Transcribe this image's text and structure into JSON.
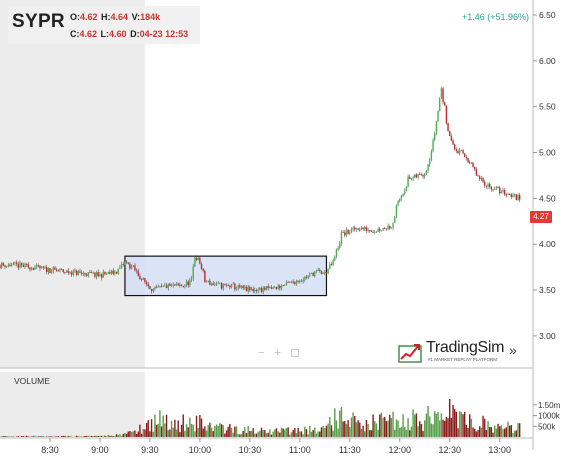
{
  "ticker": "SYPR",
  "ohlc": {
    "o_label": "O:",
    "o_value": "4.62",
    "h_label": "H:",
    "h_value": "4.64",
    "v_label": "V:",
    "v_value": "184k",
    "c_label": "C:",
    "c_value": "4.62",
    "l_label": "L:",
    "l_value": "4.60",
    "d_label": "D:",
    "d_value": "04-23 12:53"
  },
  "change_text": "+1.46 (+51.96%)",
  "last_price_tag": "4.27",
  "volume_label": "VOLUME",
  "zoom_controls": {
    "minus": "−",
    "plus": "+"
  },
  "logo": {
    "name": "TradingSim",
    "tagline": "#1 MARKET REPLAY PLATFORM",
    "chevron": "»"
  },
  "colors": {
    "up": "#4caf50",
    "down": "#c62828",
    "vol_up": "#5a9e4a",
    "vol_down": "#8b1a1a",
    "change": "#26a69a",
    "price_tag": "#e53935",
    "premarket_shade": "#ececec",
    "box_fill": "#d4dff4"
  },
  "chart_data": {
    "type": "candlestick",
    "price_axis": {
      "ticks": [
        "6.50",
        "6.00",
        "5.50",
        "5.00",
        "4.50",
        "4.00",
        "3.50",
        "3.00"
      ],
      "ylim": [
        2.65,
        6.62
      ]
    },
    "volume_axis": {
      "ticks": [
        "1.50m",
        "1000k",
        "500k"
      ],
      "ylim": [
        0,
        2100000
      ]
    },
    "time_axis": {
      "ticks": [
        "8:30",
        "9:00",
        "9:30",
        "10:00",
        "10:30",
        "11:00",
        "11:30",
        "12:00",
        "12:30",
        "13:00"
      ]
    },
    "premarket_end": "9:27",
    "consolidation_box": {
      "x_start": "9:15",
      "x_end": "11:16",
      "y_low": 3.44,
      "y_high": 3.87
    },
    "price_path": [
      [
        "8:10",
        3.77
      ],
      [
        "8:30",
        3.72
      ],
      [
        "8:45",
        3.69
      ],
      [
        "9:00",
        3.66
      ],
      [
        "9:10",
        3.7
      ],
      [
        "9:15",
        3.8
      ],
      [
        "9:20",
        3.74
      ],
      [
        "9:25",
        3.62
      ],
      [
        "9:32",
        3.5
      ],
      [
        "9:40",
        3.54
      ],
      [
        "9:50",
        3.55
      ],
      [
        "9:55",
        3.6
      ],
      [
        "9:57",
        3.88
      ],
      [
        "10:00",
        3.8
      ],
      [
        "10:03",
        3.6
      ],
      [
        "10:10",
        3.55
      ],
      [
        "10:20",
        3.54
      ],
      [
        "10:30",
        3.5
      ],
      [
        "10:45",
        3.52
      ],
      [
        "10:55",
        3.58
      ],
      [
        "11:05",
        3.65
      ],
      [
        "11:10",
        3.7
      ],
      [
        "11:15",
        3.68
      ],
      [
        "11:20",
        3.8
      ],
      [
        "11:25",
        4.1
      ],
      [
        "11:35",
        4.18
      ],
      [
        "11:45",
        4.15
      ],
      [
        "11:55",
        4.2
      ],
      [
        "12:00",
        4.5
      ],
      [
        "12:05",
        4.7
      ],
      [
        "12:15",
        4.78
      ],
      [
        "12:20",
        5.1
      ],
      [
        "12:25",
        5.7
      ],
      [
        "12:28",
        5.35
      ],
      [
        "12:32",
        5.05
      ],
      [
        "12:40",
        4.95
      ],
      [
        "12:48",
        4.7
      ],
      [
        "12:55",
        4.62
      ],
      [
        "13:05",
        4.55
      ],
      [
        "13:12",
        4.5
      ]
    ],
    "volume_path": [
      [
        "8:10",
        40000
      ],
      [
        "9:00",
        50000
      ],
      [
        "9:15",
        150000
      ],
      [
        "9:28",
        700000
      ],
      [
        "9:35",
        1100000
      ],
      [
        "9:45",
        800000
      ],
      [
        "9:57",
        1000000
      ],
      [
        "10:05",
        650000
      ],
      [
        "10:20",
        450000
      ],
      [
        "10:40",
        350000
      ],
      [
        "11:00",
        420000
      ],
      [
        "11:15",
        450000
      ],
      [
        "11:22",
        1200000
      ],
      [
        "11:30",
        900000
      ],
      [
        "11:45",
        850000
      ],
      [
        "12:00",
        1000000
      ],
      [
        "12:10",
        1100000
      ],
      [
        "12:20",
        1200000
      ],
      [
        "12:28",
        1500000
      ],
      [
        "12:40",
        900000
      ],
      [
        "12:55",
        700000
      ],
      [
        "13:12",
        500000
      ]
    ]
  }
}
